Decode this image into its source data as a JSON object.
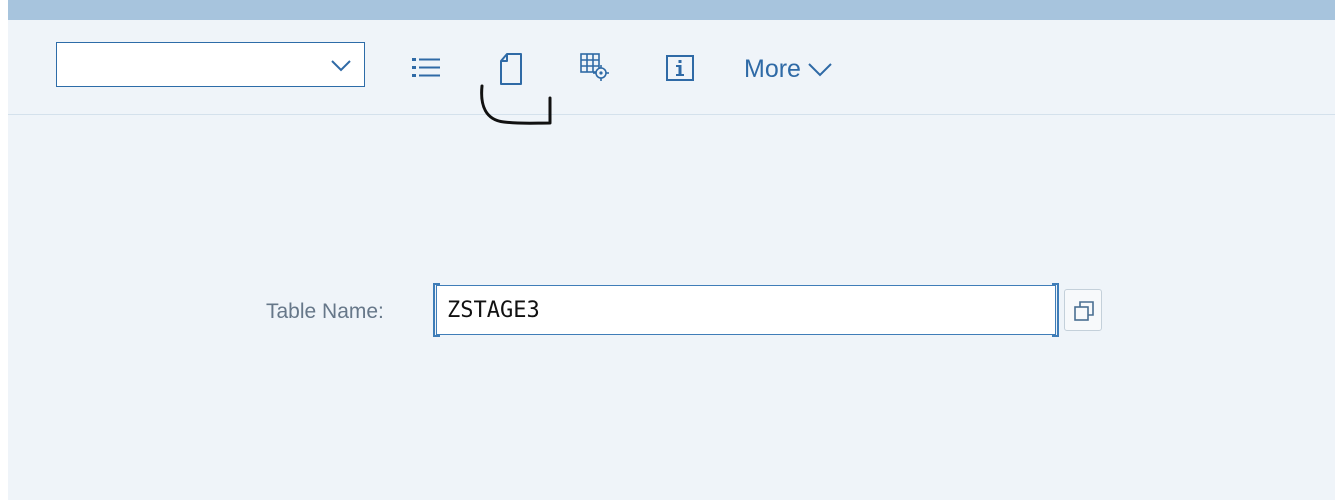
{
  "toolbar": {
    "command_field": {
      "value": "",
      "placeholder": ""
    },
    "icons": {
      "command_dropdown": "chevron-down-icon",
      "list": "list-icon",
      "new_page": "new-page-icon",
      "table_settings": "table-settings-icon",
      "info": "info-icon",
      "more_chevron": "chevron-down-icon"
    },
    "more_label": "More"
  },
  "form": {
    "table_name_label": "Table Name:",
    "table_name_value": "ZSTAGE3",
    "value_help_icon": "value-help-icon"
  },
  "colors": {
    "header_bar": "#a7c4dd",
    "background": "#eff4f9",
    "accent": "#2f6aa6",
    "label_text": "#667789",
    "annotation_stroke": "#111111"
  }
}
